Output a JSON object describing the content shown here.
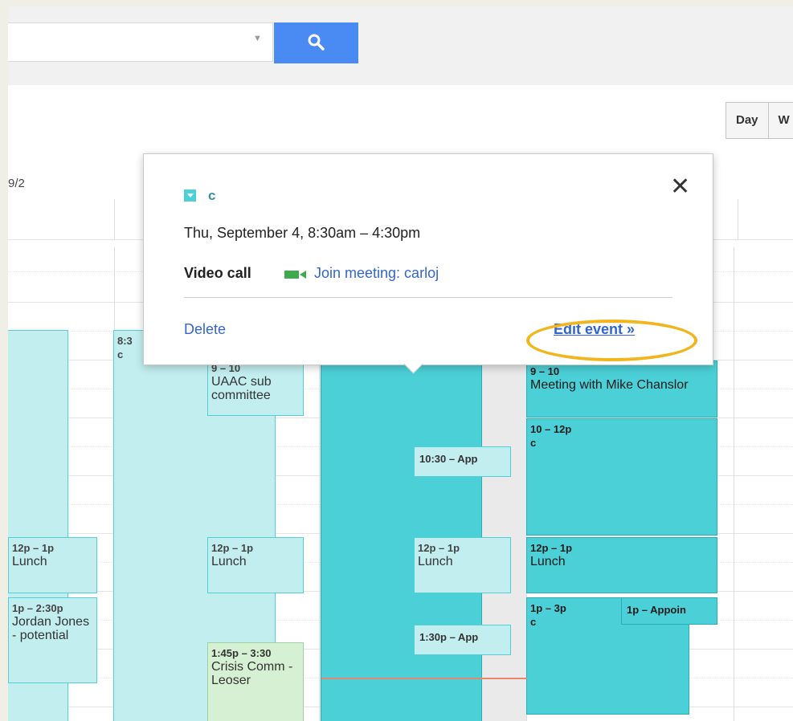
{
  "search": {
    "value": "",
    "placeholder": ""
  },
  "view_buttons": [
    "Day",
    "W"
  ],
  "day_header": "9/2",
  "events": {
    "col1_lunch": {
      "time": "12p – 1p",
      "title": "Lunch"
    },
    "col1_jordan": {
      "time": "1p – 2:30p",
      "title": "Jordan Jones - potential"
    },
    "col2_allday": {
      "time": "8:3",
      "title": "c"
    },
    "col3_uaac": {
      "time": "9 – 10",
      "title": "UAAC sub committee"
    },
    "col3_lunch": {
      "time": "12p – 1p",
      "title": "Lunch"
    },
    "col3_crisis": {
      "time": "1:45p – 3:30",
      "title": "Crisis Comm - Leoser"
    },
    "col4_appt1": {
      "time": "10:30 – App",
      "title": ""
    },
    "col4_lunch": {
      "time": "12p – 1p",
      "title": "Lunch"
    },
    "col4_appt2": {
      "time": "1:30p – App",
      "title": ""
    },
    "col5_mike": {
      "time": "9 – 10",
      "title": "Meeting with Mike Chanslor"
    },
    "col5_c": {
      "time": "10 – 12p",
      "title": "c"
    },
    "col5_lunch": {
      "time": "12p – 1p",
      "title": "Lunch"
    },
    "col5_c2": {
      "time": "1p – 3p",
      "title": "c"
    },
    "col5_appoin": {
      "time": "1p – Appoin",
      "title": ""
    }
  },
  "popup": {
    "title": "c",
    "time": "Thu, September 4, 8:30am – 4:30pm",
    "video_call_label": "Video call",
    "join_link": "Join meeting: carloj",
    "delete_label": "Delete",
    "edit_label": "Edit event »",
    "close_symbol": "✕"
  },
  "colors": {
    "event_dark": "#4bd0d7",
    "event_light": "#c2eef0",
    "search_blue": "#4a8bf3",
    "highlight": "#f2b51c",
    "now_line": "#e8866e"
  }
}
